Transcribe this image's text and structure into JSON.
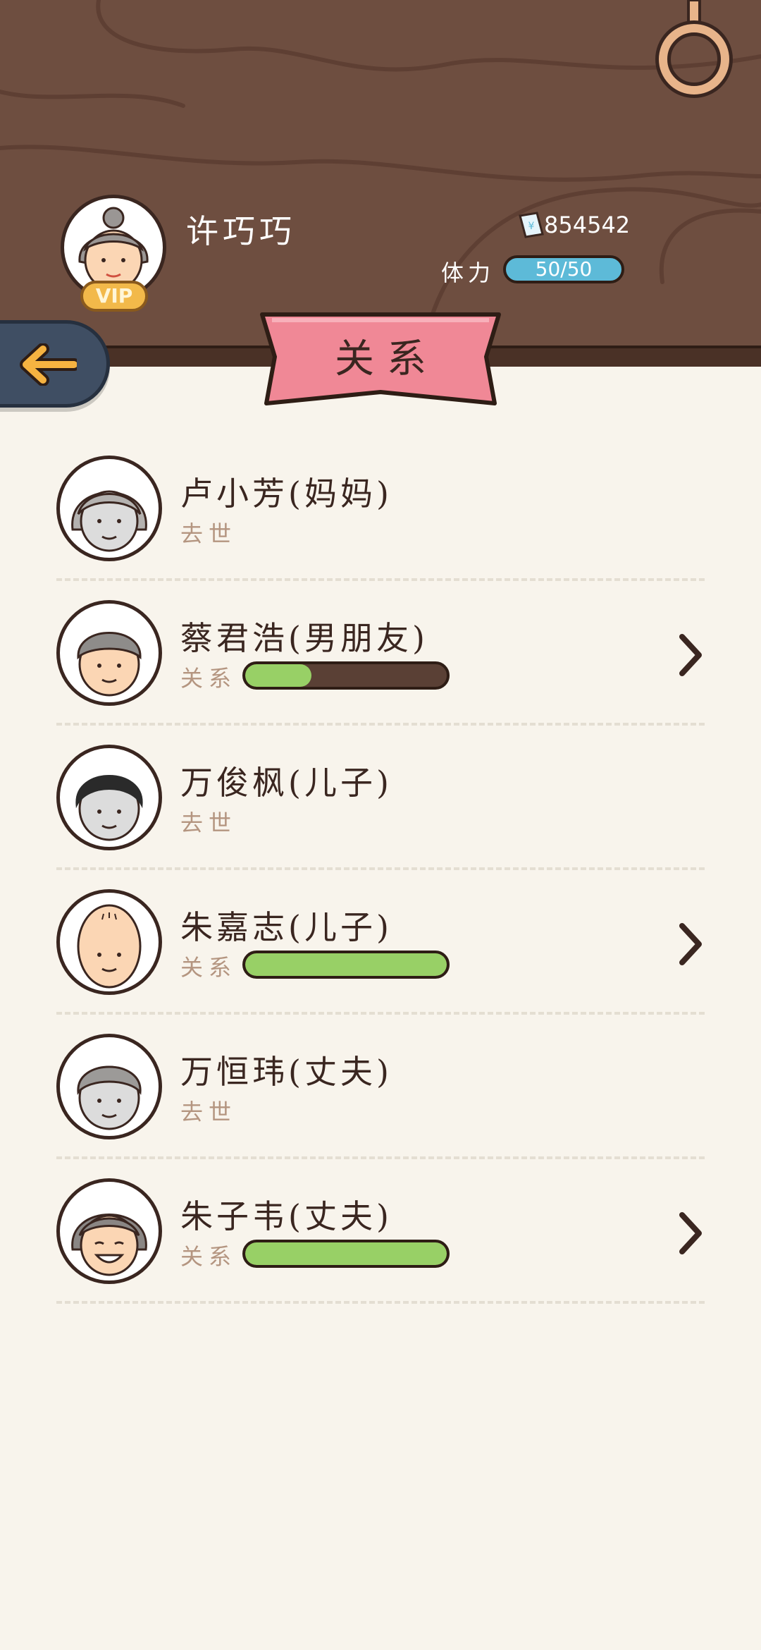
{
  "player": {
    "name": "许巧巧",
    "vip_label": "VIP",
    "money": "854542",
    "stamina_label": "体力",
    "stamina_value": "50/50"
  },
  "page": {
    "title": "关系"
  },
  "relations": [
    {
      "name": "卢小芳(妈妈)",
      "status": "去世",
      "deceased": true,
      "avatar": "grandma-gray-icon"
    },
    {
      "name": "蔡君浩(男朋友)",
      "status": "关系",
      "deceased": false,
      "affinity": 0.33,
      "avatar": "gray-hair-man-icon"
    },
    {
      "name": "万俊枫(儿子)",
      "status": "去世",
      "deceased": true,
      "avatar": "black-hair-man-icon"
    },
    {
      "name": "朱嘉志(儿子)",
      "status": "关系",
      "deceased": false,
      "affinity": 1.0,
      "avatar": "bald-man-icon"
    },
    {
      "name": "万恒玮(丈夫)",
      "status": "去世",
      "deceased": true,
      "avatar": "old-man-gray-icon"
    },
    {
      "name": "朱子韦(丈夫)",
      "status": "关系",
      "deceased": false,
      "affinity": 1.0,
      "avatar": "smiling-old-man-icon"
    }
  ],
  "colors": {
    "header_wood": "#6e4e40",
    "banner_pink": "#f08896",
    "bar_green": "#98d066",
    "bar_empty": "#5a4035",
    "stamina_blue": "#5dbad8",
    "status_text": "#b49580"
  }
}
